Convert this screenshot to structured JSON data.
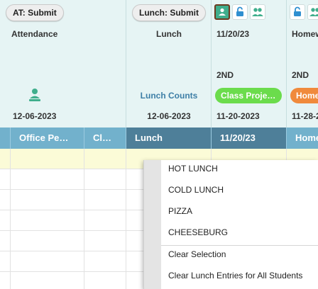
{
  "header": {
    "attendance": {
      "button_label": "AT: Submit",
      "title": "Attendance",
      "icon": "attendance-person-icon",
      "date": "12-06-2023"
    },
    "lunch": {
      "button_label": "Lunch: Submit",
      "title": "Lunch",
      "counts_link": "Lunch Counts",
      "date": "12-06-2023"
    },
    "assignment_1": {
      "icons": [
        "google-classroom-icon",
        "unlock-icon",
        "students-group-icon"
      ],
      "title": "11/20/23",
      "period": "2ND",
      "tag": "Class Proje…",
      "date": "11-20-2023"
    },
    "assignment_2": {
      "icons": [
        "unlock-icon",
        "students-group-icon"
      ],
      "title": "Homew",
      "period": "2ND",
      "tag": "Home",
      "date": "11-28-2"
    }
  },
  "grid": {
    "columns": [
      "",
      "Office Pe…",
      "Cl…",
      "Lunch",
      "11/20/23",
      "Home"
    ]
  },
  "dropdown": {
    "items": [
      "HOT LUNCH",
      "COLD LUNCH",
      "PIZZA",
      "CHEESEBURG"
    ],
    "actions": [
      "Clear Selection",
      "Clear Lunch Entries for All Students"
    ]
  },
  "colors": {
    "header_bg": "#e6f4f4",
    "grid_header_bg": "#72b1cc",
    "grid_header_active": "#4e7f99",
    "highlight_row": "#fbfbd7",
    "tag_green": "#6bdc4c",
    "tag_orange": "#f08a3c",
    "link_blue": "#3d7ea6",
    "icon_green": "#3fae8c"
  }
}
